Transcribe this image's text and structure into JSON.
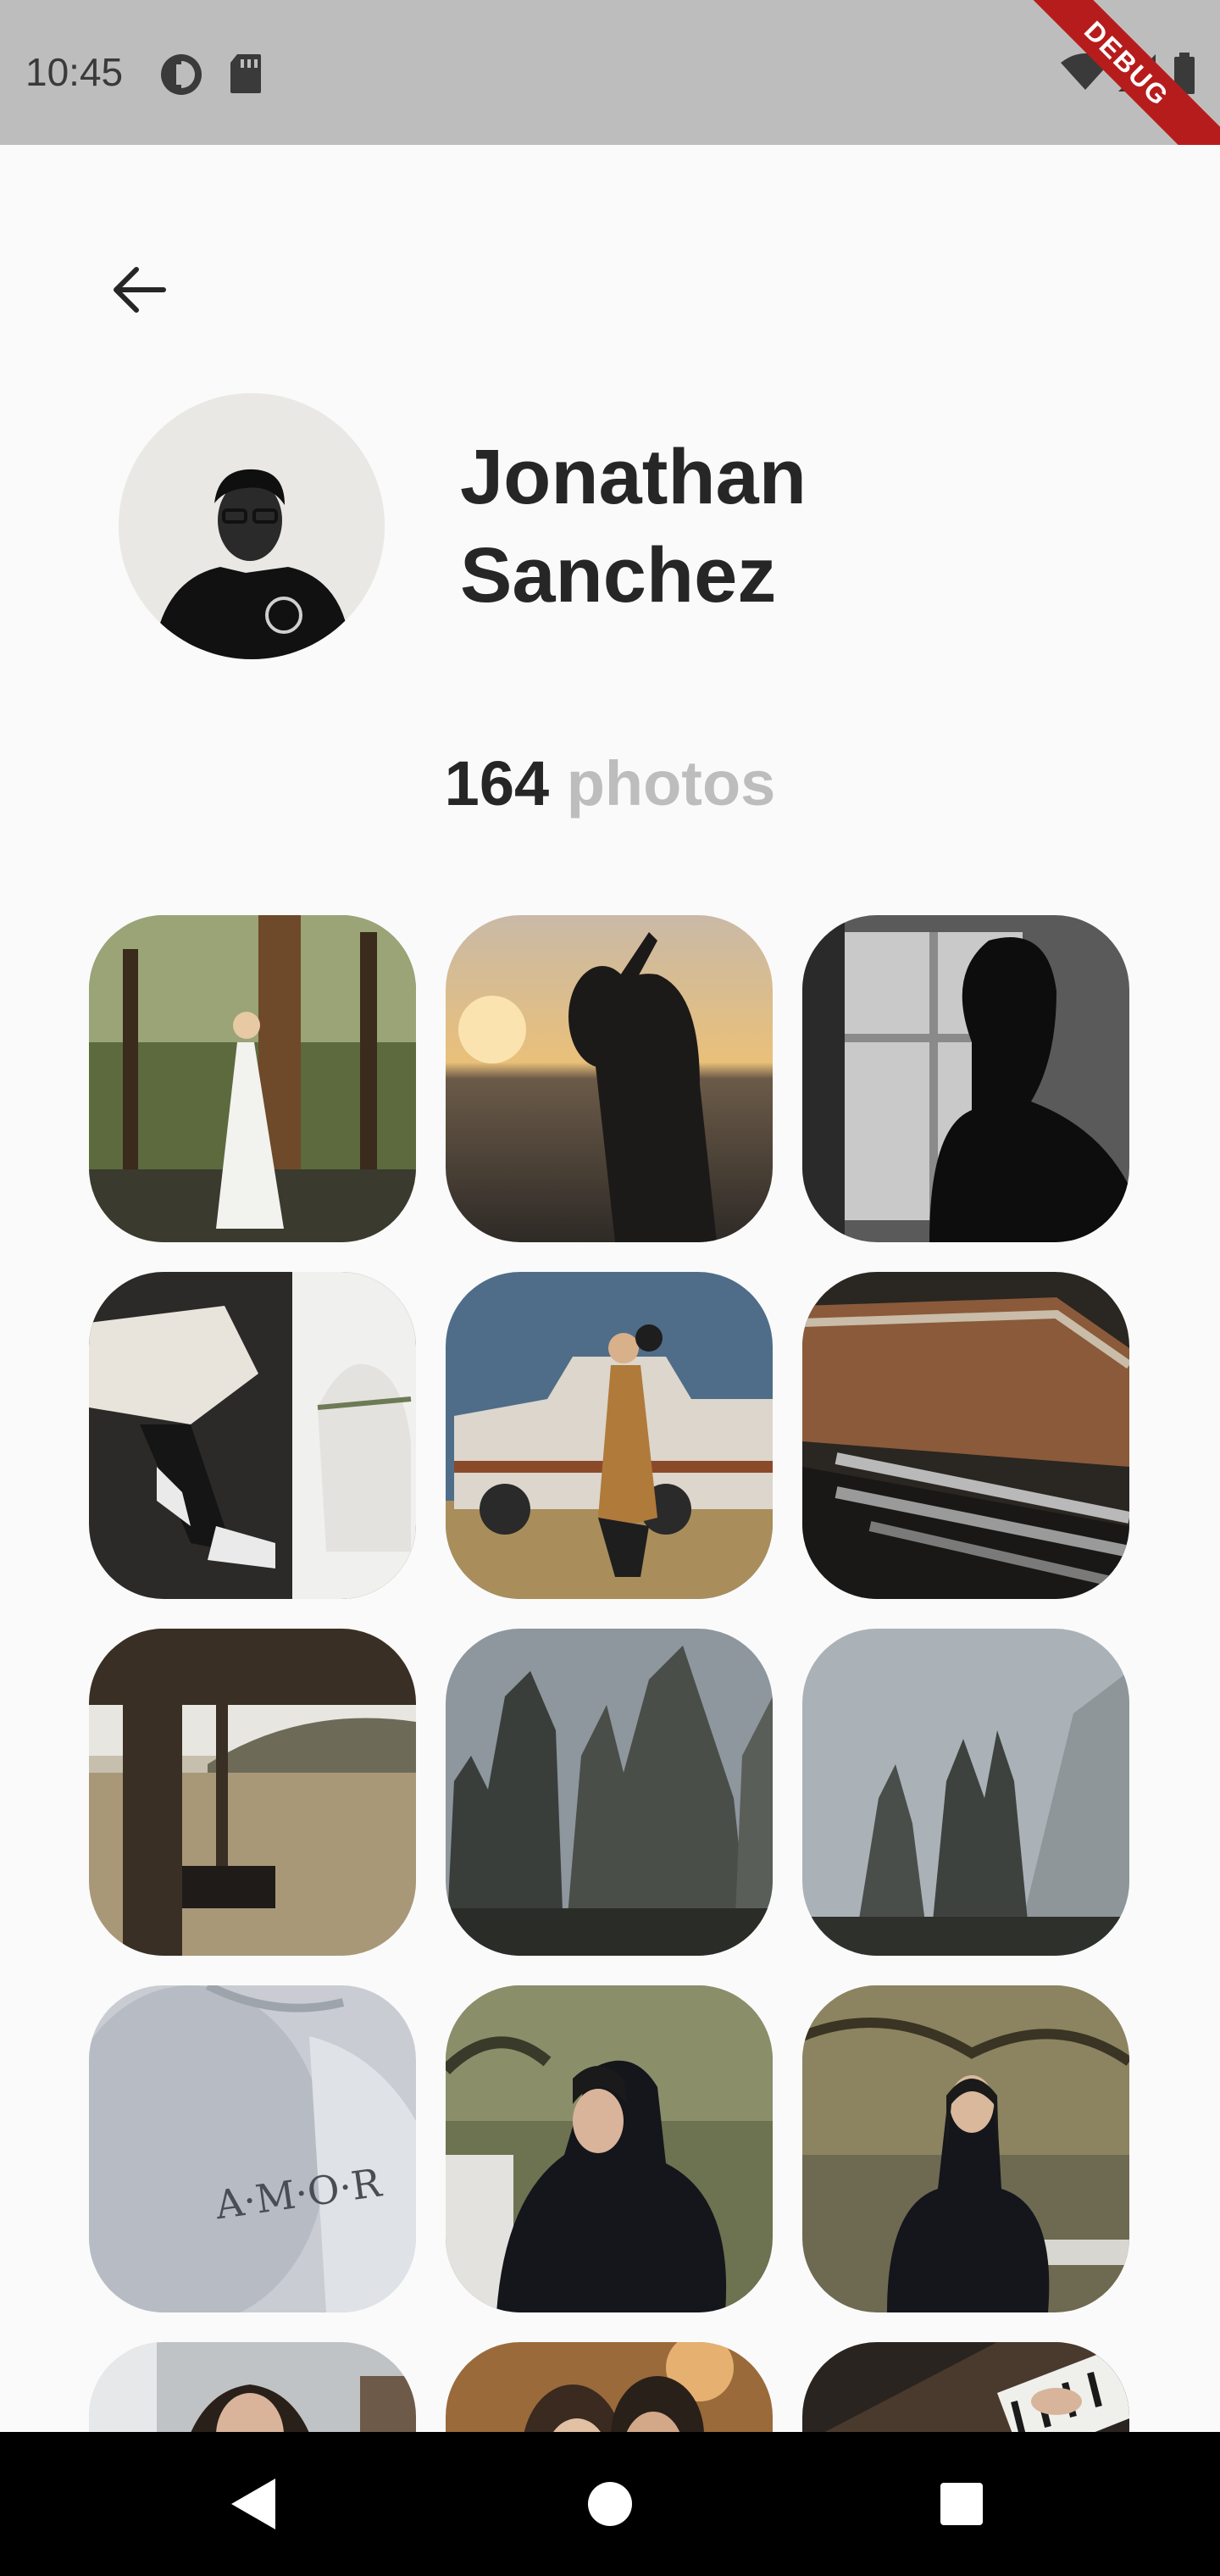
{
  "status_bar": {
    "time": "10:45",
    "icons": [
      "data-saver-icon",
      "sd-card-icon",
      "wifi-icon",
      "signal-icon",
      "battery-icon"
    ],
    "debug_label": "DEBUG"
  },
  "header": {
    "back_icon": "arrow-left-icon"
  },
  "profile": {
    "name_line1": "Jonathan",
    "name_line2": "Sanchez",
    "photo_count": "164",
    "photo_unit": "photos"
  },
  "photos": [
    {
      "subject": "bride in forest by water"
    },
    {
      "subject": "couple silhouette at sunset lake"
    },
    {
      "subject": "man silhouette by window"
    },
    {
      "subject": "person reading with sneakers"
    },
    {
      "subject": "couple by rusty truck"
    },
    {
      "subject": "rusty truck front"
    },
    {
      "subject": "porch view of field"
    },
    {
      "subject": "rock spires"
    },
    {
      "subject": "rock spires in mist"
    },
    {
      "subject": "AMOR grey sweatshirt"
    },
    {
      "subject": "woman in black hoodie"
    },
    {
      "subject": "woman in hoodie by trees"
    },
    {
      "subject": "woman portrait"
    },
    {
      "subject": "couple portrait"
    },
    {
      "subject": "piano keys"
    }
  ],
  "nav_bar": {
    "back_icon": "nav-back-icon",
    "home_icon": "nav-home-icon",
    "recents_icon": "nav-recents-icon"
  }
}
